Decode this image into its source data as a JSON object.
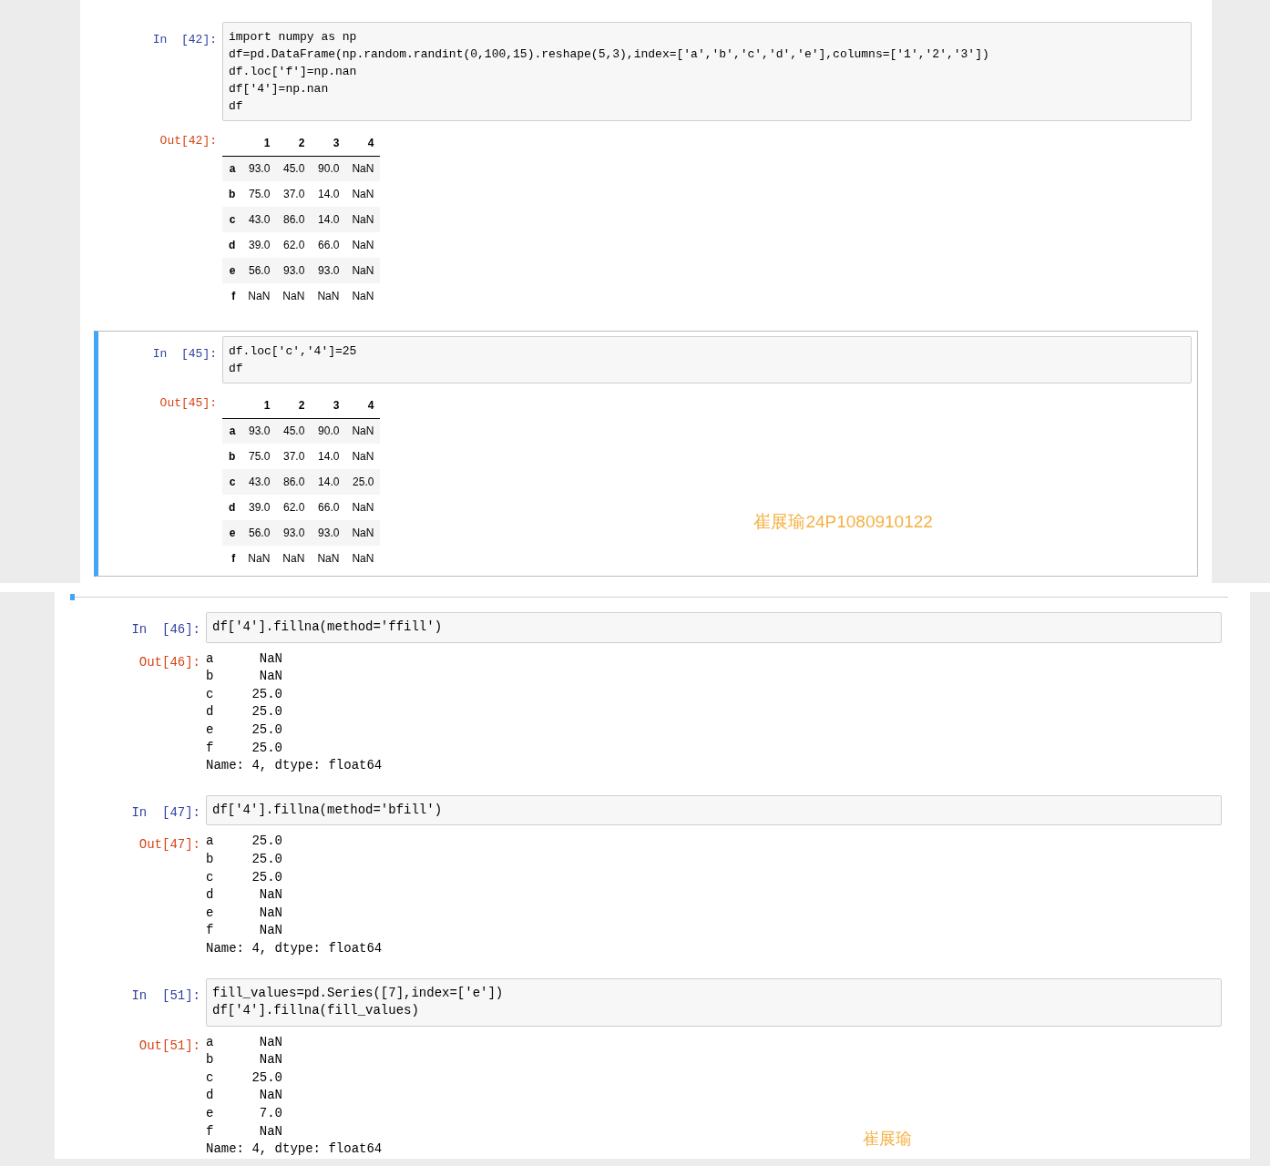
{
  "panels": [
    {
      "annotation": "崔展瑜24P1080910122",
      "cells": [
        {
          "in_prompt": "In  [42]:",
          "selected": false,
          "code": [
            "import numpy as np",
            "df=pd.DataFrame(np.random.randint(0,100,15).reshape(5,3),index=['a','b','c','d','e'],columns=['1','2','3'])",
            "df.loc['f']=np.nan",
            "df['4']=np.nan",
            "df"
          ],
          "out_prompt": "Out[42]:",
          "output": {
            "kind": "table",
            "columns": [
              "",
              "1",
              "2",
              "3",
              "4"
            ],
            "rows": [
              [
                "a",
                "93.0",
                "45.0",
                "90.0",
                "NaN"
              ],
              [
                "b",
                "75.0",
                "37.0",
                "14.0",
                "NaN"
              ],
              [
                "c",
                "43.0",
                "86.0",
                "14.0",
                "NaN"
              ],
              [
                "d",
                "39.0",
                "62.0",
                "66.0",
                "NaN"
              ],
              [
                "e",
                "56.0",
                "93.0",
                "93.0",
                "NaN"
              ],
              [
                "f",
                "NaN",
                "NaN",
                "NaN",
                "NaN"
              ]
            ]
          }
        },
        {
          "in_prompt": "In  [45]:",
          "selected": true,
          "code": [
            "df.loc['c','4']=25",
            "df"
          ],
          "out_prompt": "Out[45]:",
          "output": {
            "kind": "table",
            "columns": [
              "",
              "1",
              "2",
              "3",
              "4"
            ],
            "rows": [
              [
                "a",
                "93.0",
                "45.0",
                "90.0",
                "NaN"
              ],
              [
                "b",
                "75.0",
                "37.0",
                "14.0",
                "NaN"
              ],
              [
                "c",
                "43.0",
                "86.0",
                "14.0",
                "25.0"
              ],
              [
                "d",
                "39.0",
                "62.0",
                "66.0",
                "NaN"
              ],
              [
                "e",
                "56.0",
                "93.0",
                "93.0",
                "NaN"
              ],
              [
                "f",
                "NaN",
                "NaN",
                "NaN",
                "NaN"
              ]
            ]
          }
        }
      ]
    },
    {
      "annotation": "崔展瑜",
      "cells": [
        {
          "in_prompt": "In  [46]:",
          "selected": false,
          "code": [
            "df['4'].fillna(method='ffill')"
          ],
          "out_prompt": "Out[46]:",
          "output": {
            "kind": "text",
            "lines": [
              "a      NaN",
              "b      NaN",
              "c     25.0",
              "d     25.0",
              "e     25.0",
              "f     25.0",
              "Name: 4, dtype: float64"
            ]
          }
        },
        {
          "in_prompt": "In  [47]:",
          "selected": false,
          "code": [
            "df['4'].fillna(method='bfill')"
          ],
          "out_prompt": "Out[47]:",
          "output": {
            "kind": "text",
            "lines": [
              "a     25.0",
              "b     25.0",
              "c     25.0",
              "d      NaN",
              "e      NaN",
              "f      NaN",
              "Name: 4, dtype: float64"
            ]
          }
        },
        {
          "in_prompt": "In  [51]:",
          "selected": false,
          "code": [
            "fill_values=pd.Series([7],index=['e'])",
            "df['4'].fillna(fill_values)"
          ],
          "out_prompt": "Out[51]:",
          "output": {
            "kind": "text",
            "lines": [
              "a      NaN",
              "b      NaN",
              "c     25.0",
              "d      NaN",
              "e      7.0",
              "f      NaN",
              "Name: 4, dtype: float64"
            ]
          }
        }
      ]
    }
  ]
}
